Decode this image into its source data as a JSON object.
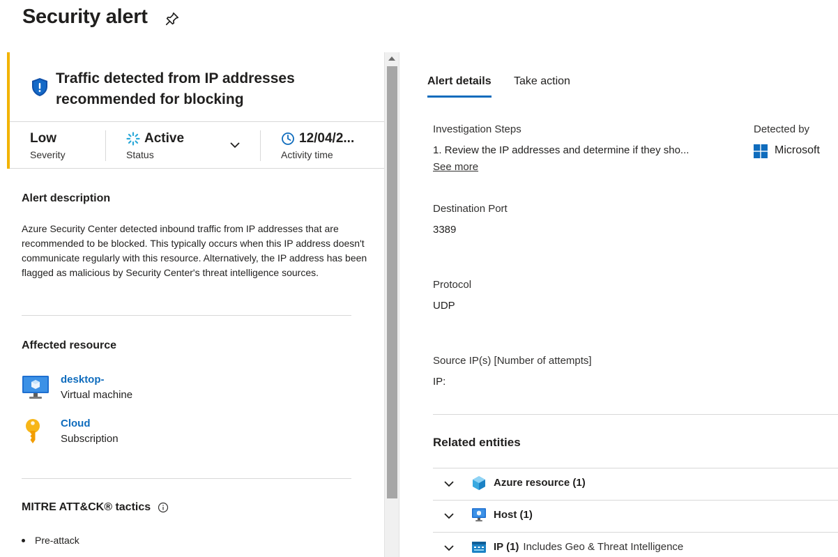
{
  "page": {
    "title": "Security alert"
  },
  "alert": {
    "title": "Traffic detected from IP addresses recommended for blocking",
    "severity": {
      "value": "Low",
      "label": "Severity"
    },
    "status": {
      "value": "Active",
      "label": "Status"
    },
    "activity_time": {
      "value": "12/04/2...",
      "label": "Activity time"
    },
    "accent_color": "#f2b300"
  },
  "description": {
    "title": "Alert description",
    "text": "Azure Security Center detected inbound traffic from IP addresses that are recommended to be blocked. This typically occurs when this IP address doesn't communicate regularly with this resource. Alternatively, the IP address has been flagged as malicious by Security Center's threat intelligence sources."
  },
  "affected_resource": {
    "title": "Affected resource",
    "items": [
      {
        "name": "desktop-",
        "type": "Virtual machine",
        "icon": "virtual-machine-icon"
      },
      {
        "name": "Cloud",
        "type": "Subscription",
        "icon": "key-icon"
      }
    ]
  },
  "mitre": {
    "title": "MITRE ATT&CK® tactics",
    "tactics": [
      "Pre-attack"
    ]
  },
  "tabs": [
    {
      "label": "Alert details",
      "active": true
    },
    {
      "label": "Take action",
      "active": false
    }
  ],
  "details": {
    "investigation": {
      "label": "Investigation Steps",
      "value": "1. Review the IP addresses and determine if they sho...",
      "see_more": "See more"
    },
    "detected_by": {
      "label": "Detected by",
      "value": "Microsoft"
    },
    "destination_port": {
      "label": "Destination Port",
      "value": "3389"
    },
    "protocol": {
      "label": "Protocol",
      "value": "UDP"
    },
    "source_ips": {
      "label": "Source IP(s) [Number of attempts]",
      "value": "IP:"
    }
  },
  "related_entities": {
    "title": "Related entities",
    "items": [
      {
        "label": "Azure resource (1)",
        "sub": "",
        "icon": "cube-icon"
      },
      {
        "label": "Host (1)",
        "sub": "",
        "icon": "monitor-icon"
      },
      {
        "label": "IP (1)",
        "sub": "Includes Geo & Threat Intelligence",
        "icon": "ip-icon"
      }
    ]
  },
  "colors": {
    "link": "#0f6cbd",
    "tab_underline": "#0f6cbd",
    "shield": "#0f6cbd"
  }
}
